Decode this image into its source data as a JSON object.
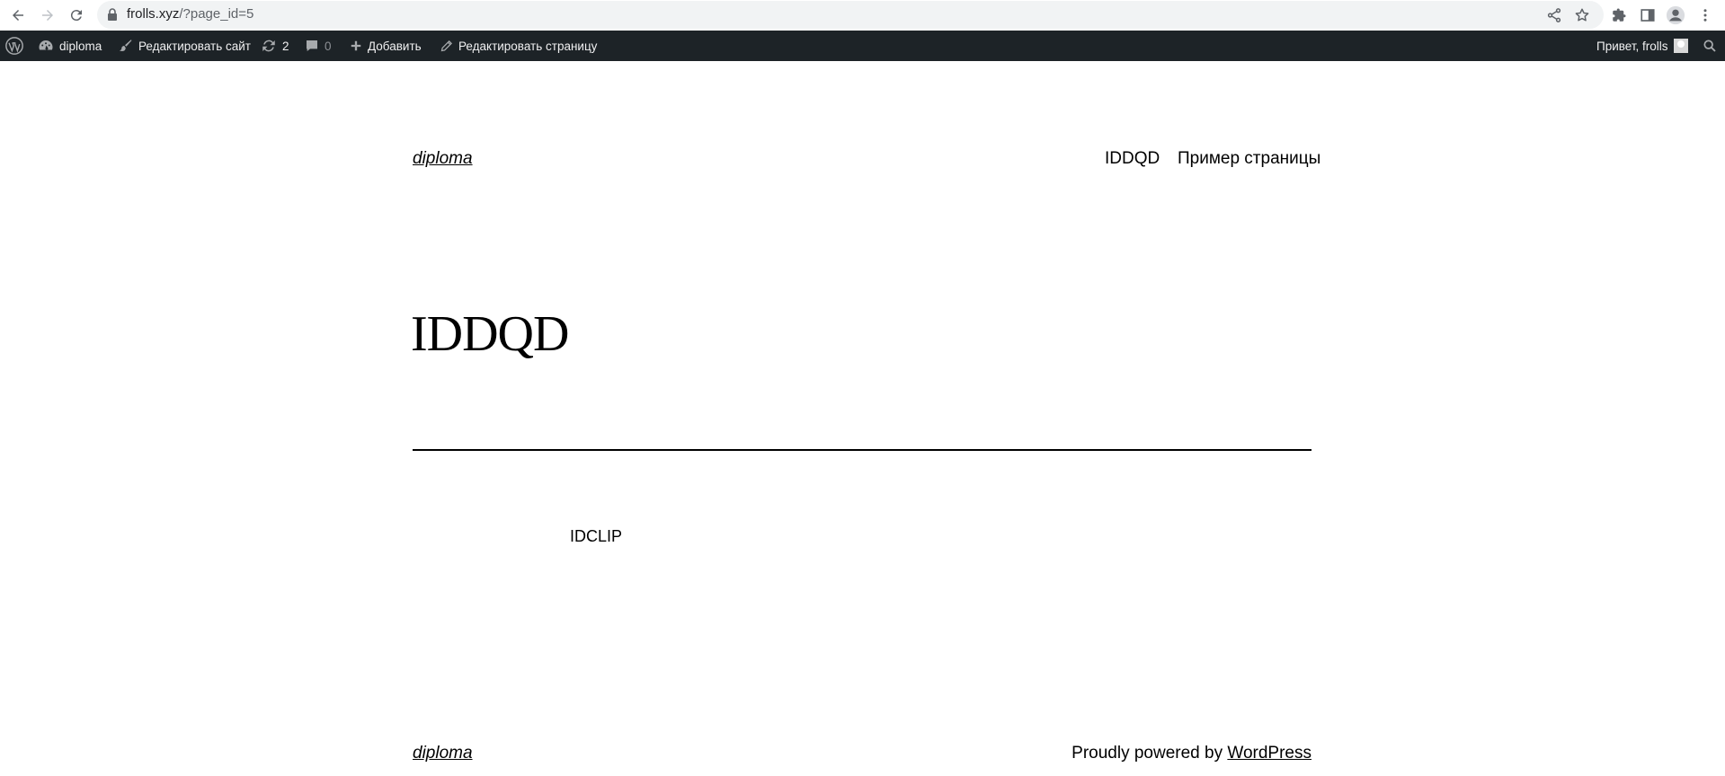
{
  "browser": {
    "url_host": "frolls.xyz",
    "url_path": "/?page_id=5",
    "icons": [
      "back-icon",
      "forward-icon",
      "reload-icon",
      "lock-icon",
      "share-icon",
      "star-icon",
      "extensions-icon",
      "side-panel-icon",
      "profile-icon",
      "menu-icon"
    ]
  },
  "adminbar": {
    "site_name": "diploma",
    "customize_label": "Редактировать сайт",
    "updates_count": "2",
    "comments_count": "0",
    "new_label": "Добавить",
    "edit_page_label": "Редактировать страницу",
    "greeting": "Привет, frolls"
  },
  "site": {
    "title": "diploma",
    "menu": [
      "IDDQD",
      "Пример страницы"
    ]
  },
  "page": {
    "title": "IDDQD",
    "content": "IDCLIP"
  },
  "footer": {
    "title": "diploma",
    "credit_prefix": "Proudly powered by ",
    "credit_link": "WordPress"
  }
}
